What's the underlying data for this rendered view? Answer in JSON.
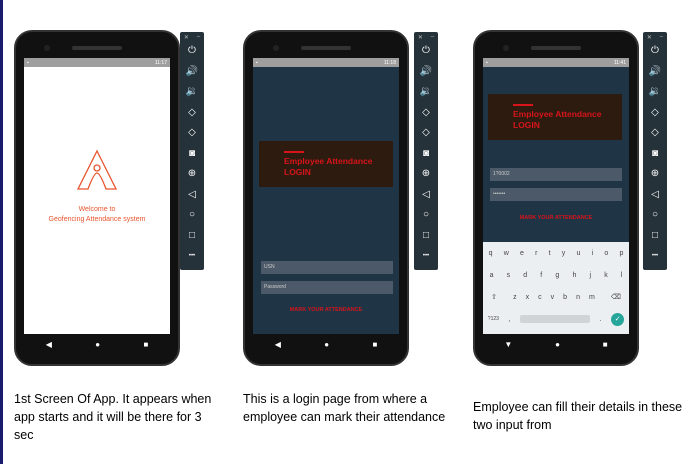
{
  "toolbar_icons": [
    "close-icon",
    "minimize-icon",
    "power-icon",
    "volume-up-icon",
    "volume-down-icon",
    "rotate-left-icon",
    "rotate-right-icon",
    "camera-icon",
    "zoom-icon",
    "back-icon",
    "home-icon",
    "overview-icon",
    "more-icon"
  ],
  "phones": [
    {
      "time": "11:17",
      "welcome_line1": "Welcome to",
      "welcome_line2": "Geofencing Attendance system",
      "caption": "1st Screen Of App. It appears when app starts and it will be there for 3 sec"
    },
    {
      "time": "11:18",
      "banner_title": "Employee Attendance",
      "banner_subtitle": "LOGIN",
      "usn_placeholder": "USN",
      "password_placeholder": "Password",
      "button": "MARK YOUR ATTENDANCE",
      "caption": "This is a login page from where a employee can mark their attendance"
    },
    {
      "time": "11:41",
      "banner_title": "Employee Attendance",
      "banner_subtitle": "LOGIN",
      "usn_value": "1?0002",
      "password_value": "•••••••",
      "button": "MARK YOUR ATTENDANCE",
      "keyboard": {
        "row1": [
          "q",
          "w",
          "e",
          "r",
          "t",
          "y",
          "u",
          "i",
          "o",
          "p"
        ],
        "row2": [
          "a",
          "s",
          "d",
          "f",
          "g",
          "h",
          "j",
          "k",
          "l"
        ],
        "row3": [
          "z",
          "x",
          "c",
          "v",
          "b",
          "n",
          "m"
        ],
        "symbols": "?123"
      },
      "caption": "Employee can fill their details in these two input from"
    }
  ]
}
